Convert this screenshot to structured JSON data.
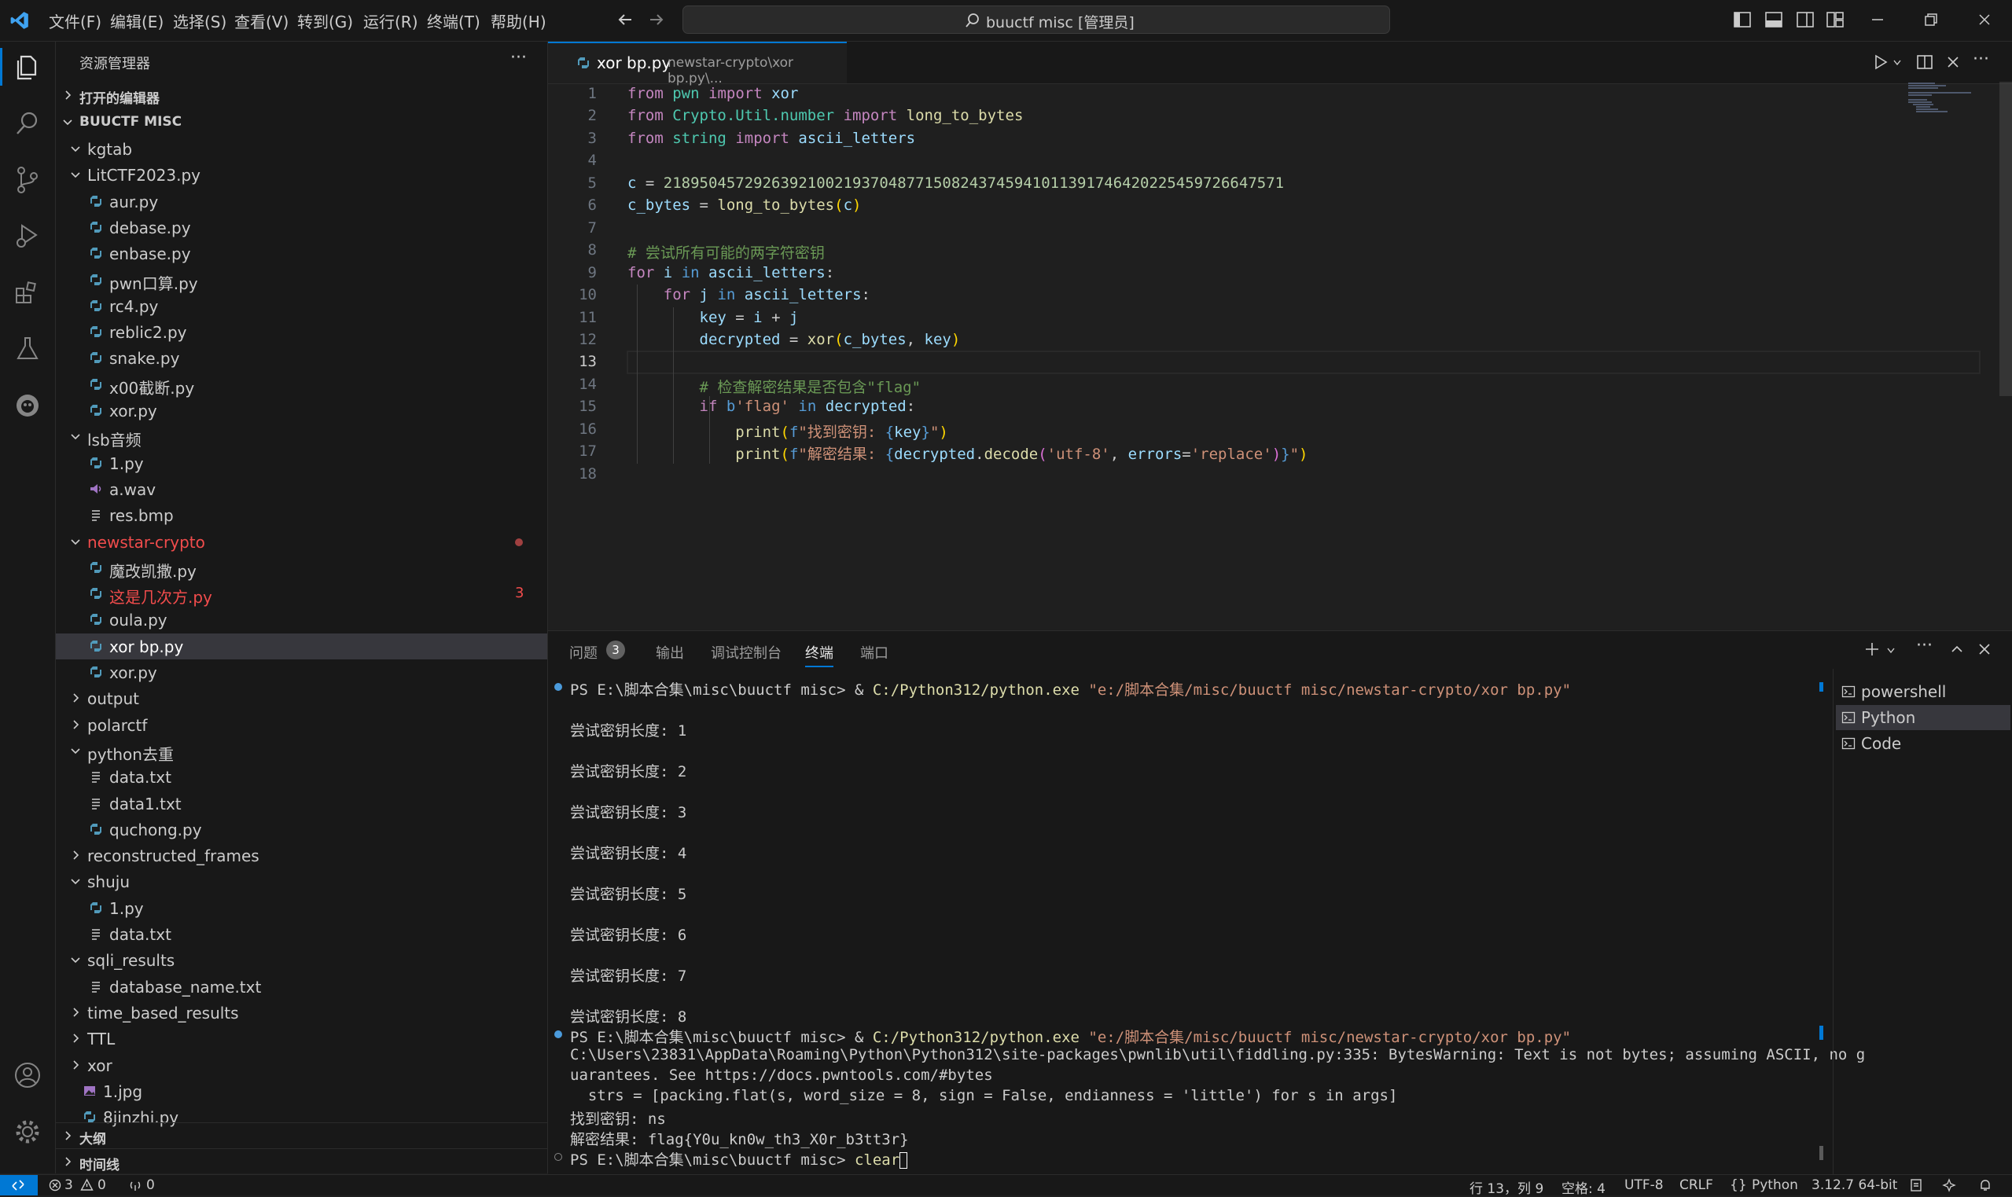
{
  "menu": [
    "文件(F)",
    "编辑(E)",
    "选择(S)",
    "查看(V)",
    "转到(G)",
    "运行(R)",
    "终端(T)",
    "帮助(H)"
  ],
  "search": {
    "label": "buuctf misc [管理员]"
  },
  "sidebar": {
    "title": "资源管理器",
    "open_editors": "打开的编辑器",
    "root": "BUUCTF MISC",
    "outline": "大纲",
    "timeline": "时间线",
    "items": [
      {
        "label": "kgtab",
        "depth": 1,
        "kind": "folder-open"
      },
      {
        "label": "LitCTF2023.py",
        "depth": 1,
        "kind": "folder-open"
      },
      {
        "label": "aur.py",
        "depth": 2,
        "kind": "py"
      },
      {
        "label": "debase.py",
        "depth": 2,
        "kind": "py"
      },
      {
        "label": "enbase.py",
        "depth": 2,
        "kind": "py"
      },
      {
        "label": "pwn口算.py",
        "depth": 2,
        "kind": "py"
      },
      {
        "label": "rc4.py",
        "depth": 2,
        "kind": "py"
      },
      {
        "label": "reblic2.py",
        "depth": 2,
        "kind": "py"
      },
      {
        "label": "snake.py",
        "depth": 2,
        "kind": "py"
      },
      {
        "label": "x00截断.py",
        "depth": 2,
        "kind": "py"
      },
      {
        "label": "xor.py",
        "depth": 2,
        "kind": "py"
      },
      {
        "label": "lsb音频",
        "depth": 1,
        "kind": "folder-open"
      },
      {
        "label": "1.py",
        "depth": 2,
        "kind": "py"
      },
      {
        "label": "a.wav",
        "depth": 2,
        "kind": "audio"
      },
      {
        "label": "res.bmp",
        "depth": 2,
        "kind": "txt"
      },
      {
        "label": "newstar-crypto",
        "depth": 1,
        "kind": "folder-open",
        "status": "error"
      },
      {
        "label": "魔改凯撒.py",
        "depth": 2,
        "kind": "py"
      },
      {
        "label": "这是几次方.py",
        "depth": 2,
        "kind": "py",
        "status": "error",
        "badge": "3"
      },
      {
        "label": "oula.py",
        "depth": 2,
        "kind": "py"
      },
      {
        "label": "xor bp.py",
        "depth": 2,
        "kind": "py",
        "selected": true
      },
      {
        "label": "xor.py",
        "depth": 2,
        "kind": "py"
      },
      {
        "label": "output",
        "depth": 1,
        "kind": "folder"
      },
      {
        "label": "polarctf",
        "depth": 1,
        "kind": "folder"
      },
      {
        "label": "python去重",
        "depth": 1,
        "kind": "folder-open"
      },
      {
        "label": "data.txt",
        "depth": 2,
        "kind": "txt"
      },
      {
        "label": "data1.txt",
        "depth": 2,
        "kind": "txt"
      },
      {
        "label": "quchong.py",
        "depth": 2,
        "kind": "py"
      },
      {
        "label": "reconstructed_frames",
        "depth": 1,
        "kind": "folder"
      },
      {
        "label": "shuju",
        "depth": 1,
        "kind": "folder-open"
      },
      {
        "label": "1.py",
        "depth": 2,
        "kind": "py"
      },
      {
        "label": "data.txt",
        "depth": 2,
        "kind": "txt"
      },
      {
        "label": "sqli_results",
        "depth": 1,
        "kind": "folder-open"
      },
      {
        "label": "database_name.txt",
        "depth": 2,
        "kind": "txt"
      },
      {
        "label": "time_based_results",
        "depth": 1,
        "kind": "folder"
      },
      {
        "label": "TTL",
        "depth": 1,
        "kind": "folder"
      },
      {
        "label": "xor",
        "depth": 1,
        "kind": "folder"
      },
      {
        "label": "1.jpg",
        "depth": 1,
        "kind": "img"
      },
      {
        "label": "8jinzhi.py",
        "depth": 1,
        "kind": "py"
      }
    ]
  },
  "editor": {
    "tab_name": "xor bp.py",
    "tab_path": "newstar-crypto\\xor bp.py\\...",
    "current_line": 13,
    "code": [
      [
        [
          "kw",
          "from"
        ],
        [
          "pl",
          " "
        ],
        [
          "mod",
          "pwn"
        ],
        [
          "pl",
          " "
        ],
        [
          "kw",
          "import"
        ],
        [
          "pl",
          " "
        ],
        [
          "vr",
          "xor"
        ]
      ],
      [
        [
          "kw",
          "from"
        ],
        [
          "pl",
          " "
        ],
        [
          "mod",
          "Crypto.Util.number"
        ],
        [
          "pl",
          " "
        ],
        [
          "kw",
          "import"
        ],
        [
          "pl",
          " "
        ],
        [
          "fn",
          "long_to_bytes"
        ]
      ],
      [
        [
          "kw",
          "from"
        ],
        [
          "pl",
          " "
        ],
        [
          "mod",
          "string"
        ],
        [
          "pl",
          " "
        ],
        [
          "kw",
          "import"
        ],
        [
          "pl",
          " "
        ],
        [
          "vr",
          "ascii_letters"
        ]
      ],
      [],
      [
        [
          "vr",
          "c"
        ],
        [
          "pl",
          " = "
        ],
        [
          "nm",
          "21895045729263921002193704877150824374594101139174642022545972664757​1"
        ]
      ],
      [
        [
          "vr",
          "c_bytes"
        ],
        [
          "pl",
          " = "
        ],
        [
          "fn",
          "long_to_bytes"
        ],
        [
          "br2",
          "("
        ],
        [
          "vr",
          "c"
        ],
        [
          "br2",
          ")"
        ]
      ],
      [],
      [
        [
          "cm",
          "# 尝试所有可能的两字符密钥"
        ]
      ],
      [
        [
          "kw",
          "for"
        ],
        [
          "pl",
          " "
        ],
        [
          "vr",
          "i"
        ],
        [
          "pl",
          " "
        ],
        [
          "kw2",
          "in"
        ],
        [
          "pl",
          " "
        ],
        [
          "vr",
          "ascii_letters"
        ],
        [
          "pl",
          ":"
        ]
      ],
      [
        [
          "pl",
          "    "
        ],
        [
          "kw",
          "for"
        ],
        [
          "pl",
          " "
        ],
        [
          "vr",
          "j"
        ],
        [
          "pl",
          " "
        ],
        [
          "kw2",
          "in"
        ],
        [
          "pl",
          " "
        ],
        [
          "vr",
          "ascii_letters"
        ],
        [
          "pl",
          ":"
        ]
      ],
      [
        [
          "pl",
          "        "
        ],
        [
          "vr",
          "key"
        ],
        [
          "pl",
          " = "
        ],
        [
          "vr",
          "i"
        ],
        [
          "pl",
          " + "
        ],
        [
          "vr",
          "j"
        ]
      ],
      [
        [
          "pl",
          "        "
        ],
        [
          "vr",
          "decrypted"
        ],
        [
          "pl",
          " = "
        ],
        [
          "fn",
          "xor"
        ],
        [
          "br2",
          "("
        ],
        [
          "vr",
          "c_bytes"
        ],
        [
          "pl",
          ", "
        ],
        [
          "vr",
          "key"
        ],
        [
          "br2",
          ")"
        ]
      ],
      [],
      [
        [
          "pl",
          "        "
        ],
        [
          "cm",
          "# 检查解密结果是否包含\"flag\""
        ]
      ],
      [
        [
          "pl",
          "        "
        ],
        [
          "kw",
          "if"
        ],
        [
          "pl",
          " "
        ],
        [
          "kw2",
          "b"
        ],
        [
          "st",
          "'flag'"
        ],
        [
          "pl",
          " "
        ],
        [
          "kw2",
          "in"
        ],
        [
          "pl",
          " "
        ],
        [
          "vr",
          "decrypted"
        ],
        [
          "pl",
          ":"
        ]
      ],
      [
        [
          "pl",
          "            "
        ],
        [
          "fn",
          "print"
        ],
        [
          "br2",
          "("
        ],
        [
          "kw2",
          "f"
        ],
        [
          "st",
          "\"找到密钥: "
        ],
        [
          "kw2",
          "{"
        ],
        [
          "vr",
          "key"
        ],
        [
          "kw2",
          "}"
        ],
        [
          "st",
          "\""
        ],
        [
          "br2",
          ")"
        ]
      ],
      [
        [
          "pl",
          "            "
        ],
        [
          "fn",
          "print"
        ],
        [
          "br2",
          "("
        ],
        [
          "kw2",
          "f"
        ],
        [
          "st",
          "\"解密结果: "
        ],
        [
          "kw2",
          "{"
        ],
        [
          "vr",
          "decrypted"
        ],
        [
          "pl",
          "."
        ],
        [
          "fn",
          "decode"
        ],
        [
          "br",
          "("
        ],
        [
          "st",
          "'utf-8'"
        ],
        [
          "pl",
          ", "
        ],
        [
          "vr",
          "errors"
        ],
        [
          "pl",
          "="
        ],
        [
          "st",
          "'replace'"
        ],
        [
          "br",
          ")"
        ],
        [
          "kw2",
          "}"
        ],
        [
          "st",
          "\""
        ],
        [
          "br2",
          ")"
        ]
      ],
      []
    ]
  },
  "panel": {
    "tabs": [
      "问题",
      "输出",
      "调试控制台",
      "终端",
      "端口"
    ],
    "problems_count": "3",
    "active_tab": "终端",
    "terminals": [
      "powershell",
      "Python",
      "Code"
    ],
    "terminal_lines": [
      {
        "type": "prompt",
        "parts": [
          [
            "pl",
            "PS E:\\脚本合集\\misc\\buuctf misc> & "
          ],
          [
            "fn",
            "C:/Python312/python.exe"
          ],
          [
            "pl",
            " "
          ],
          [
            "vr",
            "\"e:/脚本合集/misc/buuctf misc/newstar-crypto/xor bp.py\""
          ]
        ]
      },
      {
        "type": "text",
        "text": "尝试密钥长度: 1"
      },
      {
        "type": "text",
        "text": "尝试密钥长度: 2"
      },
      {
        "type": "text",
        "text": "尝试密钥长度: 3"
      },
      {
        "type": "text",
        "text": "尝试密钥长度: 4"
      },
      {
        "type": "text",
        "text": "尝试密钥长度: 5"
      },
      {
        "type": "text",
        "text": "尝试密钥长度: 6"
      },
      {
        "type": "text",
        "text": "尝试密钥长度: 7"
      },
      {
        "type": "text",
        "text": "尝试密钥长度: 8"
      },
      {
        "type": "prompt",
        "parts": [
          [
            "pl",
            "PS E:\\脚本合集\\misc\\buuctf misc> & "
          ],
          [
            "fn",
            "C:/Python312/python.exe"
          ],
          [
            "pl",
            " "
          ],
          [
            "vr",
            "\"e:/脚本合集/misc/buuctf misc/newstar-crypto/xor bp.py\""
          ]
        ]
      },
      {
        "type": "text",
        "text": "C:\\Users\\23831\\AppData\\Roaming\\Python\\Python312\\site-packages\\pwnlib\\util\\fiddling.py:335: BytesWarning: Text is not bytes; assuming ASCII, no g"
      },
      {
        "type": "text",
        "text": "uarantees. See https://docs.pwntools.com/#bytes"
      },
      {
        "type": "text",
        "text": "  strs = [packing.flat(s, word_size = 8, sign = False, endianness = 'little') for s in args]"
      },
      {
        "type": "text",
        "text": "找到密钥: ns"
      },
      {
        "type": "text",
        "text": "解密结果: flag{Y0u_kn0w_th3_X0r_b3tt3r}"
      },
      {
        "type": "prompt-empty",
        "parts": [
          [
            "pl",
            "PS E:\\脚本合集\\misc\\buuctf misc> "
          ],
          [
            "fn",
            "clear"
          ]
        ]
      }
    ]
  },
  "status": {
    "errors": "3",
    "warnings": "0",
    "ports": "0",
    "position": "行 13，列 9",
    "spaces": "空格: 4",
    "encoding": "UTF-8",
    "eol": "CRLF",
    "language": "Python",
    "interpreter": "3.12.7 64-bit"
  },
  "colors": {
    "accent": "#0078d4",
    "error": "#f14c4c",
    "python_icon": "#519aba"
  }
}
